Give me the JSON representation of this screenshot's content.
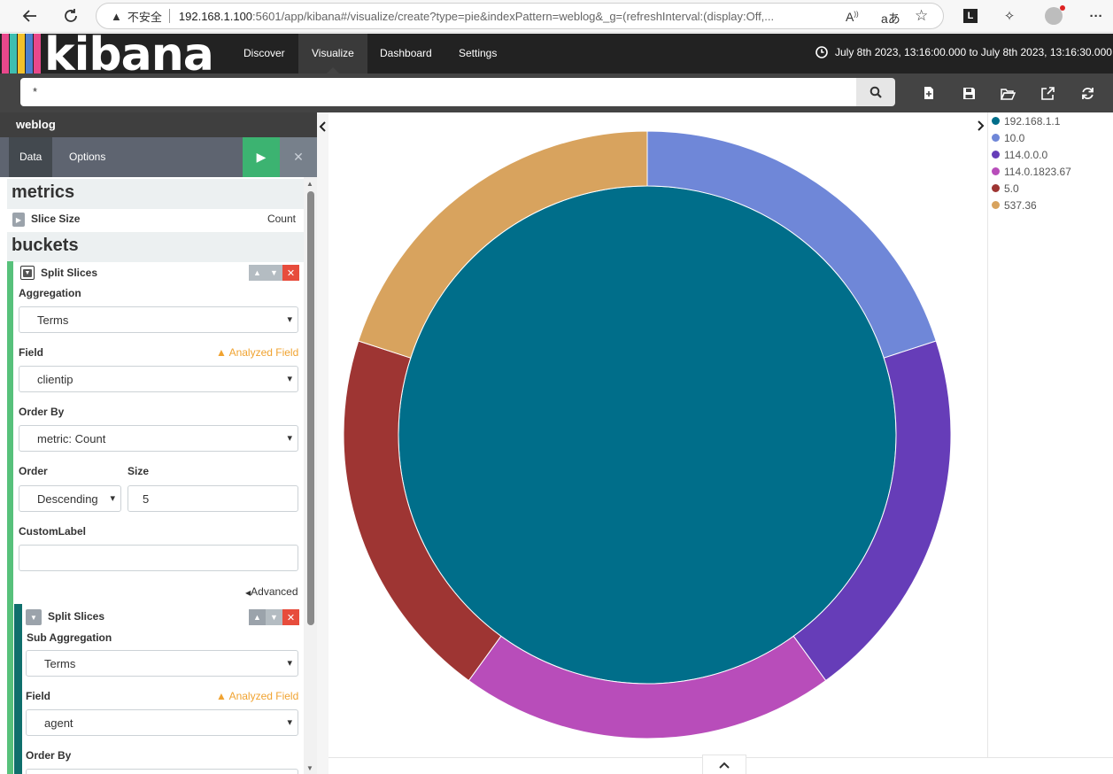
{
  "browser": {
    "security_label": "不安全",
    "url_host": "192.168.1.100",
    "url_rest": ":5601/app/kibana#/visualize/create?type=pie&indexPattern=weblog&_g=(refreshInterval:(display:Off,..."
  },
  "kibana": {
    "logo_text": "kibana",
    "nav": [
      {
        "label": "Discover"
      },
      {
        "label": "Visualize"
      },
      {
        "label": "Dashboard"
      },
      {
        "label": "Settings"
      }
    ],
    "time_range": "July 8th 2023, 13:16:00.000 to July 8th 2023, 13:16:30.000"
  },
  "search": {
    "query": "*"
  },
  "sidebar": {
    "index_pattern": "weblog",
    "tabs": [
      "Data",
      "Options"
    ],
    "metrics_heading": "metrics",
    "metric": {
      "label": "Slice Size",
      "value": "Count"
    },
    "buckets_heading": "buckets",
    "bucket1": {
      "title": "Split Slices",
      "aggregation_label": "Aggregation",
      "aggregation": "Terms",
      "field_label": "Field",
      "analyzed_label": "Analyzed Field",
      "field": "clientip",
      "orderby_label": "Order By",
      "orderby": "metric: Count",
      "order_label": "Order",
      "order": "Descending",
      "size_label": "Size",
      "size": "5",
      "customlabel_label": "CustomLabel",
      "customlabel": "",
      "advanced_label": "Advanced"
    },
    "bucket2": {
      "title": "Split Slices",
      "aggregation_label": "Sub Aggregation",
      "aggregation": "Terms",
      "field_label": "Field",
      "analyzed_label": "Analyzed Field",
      "field": "agent",
      "orderby_label": "Order By"
    }
  },
  "chart_data": {
    "type": "pie",
    "donut_rings": [
      {
        "ring": "inner",
        "slices": [
          {
            "label": "192.168.1.1",
            "value": 100,
            "color": "#006e8a"
          }
        ]
      },
      {
        "ring": "outer",
        "slices": [
          {
            "label": "10.0",
            "value": 20,
            "color": "#6f87d8"
          },
          {
            "label": "114.0.0.0",
            "value": 20,
            "color": "#663db8"
          },
          {
            "label": "114.0.1823.67",
            "value": 20,
            "color": "#b84dba"
          },
          {
            "label": "5.0",
            "value": 20,
            "color": "#9e3533"
          },
          {
            "label": "537.36",
            "value": 20,
            "color": "#d8a35e"
          }
        ]
      }
    ],
    "legend": [
      {
        "label": "192.168.1.1",
        "color": "#006e8a"
      },
      {
        "label": "10.0",
        "color": "#6f87d8"
      },
      {
        "label": "114.0.0.0",
        "color": "#663db8"
      },
      {
        "label": "114.0.1823.67",
        "color": "#b84dba"
      },
      {
        "label": "5.0",
        "color": "#9e3533"
      },
      {
        "label": "537.36",
        "color": "#d8a35e"
      }
    ],
    "legend_position": "right"
  }
}
